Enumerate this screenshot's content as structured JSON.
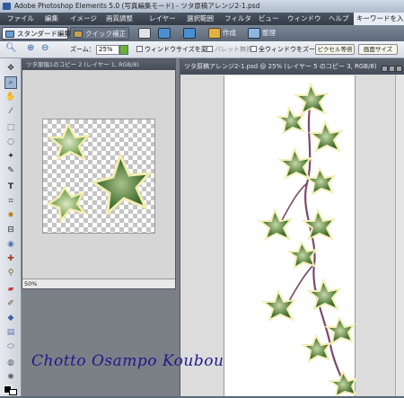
{
  "window": {
    "title": "Adobe Photoshop Elements 5.0 (写真編集モード) - ツタ原稿アレンジ2-1.psd"
  },
  "menu": {
    "items": [
      "ファイル",
      "編集",
      "イメージ",
      "画質調整",
      "レイヤー",
      "選択範囲",
      "フィルタ",
      "ビュー",
      "ウィンドウ",
      "ヘルプ"
    ],
    "search_label": "キーワードを入力"
  },
  "modes": {
    "standard": "スタンダード編集",
    "quick": "クイック補正",
    "create": "作成",
    "organize": "整理"
  },
  "options": {
    "zoom_label": "ズーム：",
    "zoom_value": "25%",
    "resize_windows": "ウィンドウサイズを変更",
    "ignore_palettes": "パレット無視",
    "zoom_all": "全ウィンドウをズーム",
    "actual_pixels": "ピクセル等倍",
    "fit_screen": "画面サイズ"
  },
  "document_left": {
    "title": "ツタ原稿1のコピー 2 (レイヤー 1, RGB/8)",
    "zoom": "50%"
  },
  "document_right": {
    "title": "ツタ原稿アレンジ2-1.psd @ 25% (レイヤー 5 のコピー 3, RGB/8)"
  },
  "watermark": "Chotto Osampo Koubou",
  "colors": {
    "leaf_dark": "#2f5a24",
    "leaf_light": "#7fa85a",
    "stem": "#7a4a6a",
    "watermark": "#1d1a8c"
  }
}
